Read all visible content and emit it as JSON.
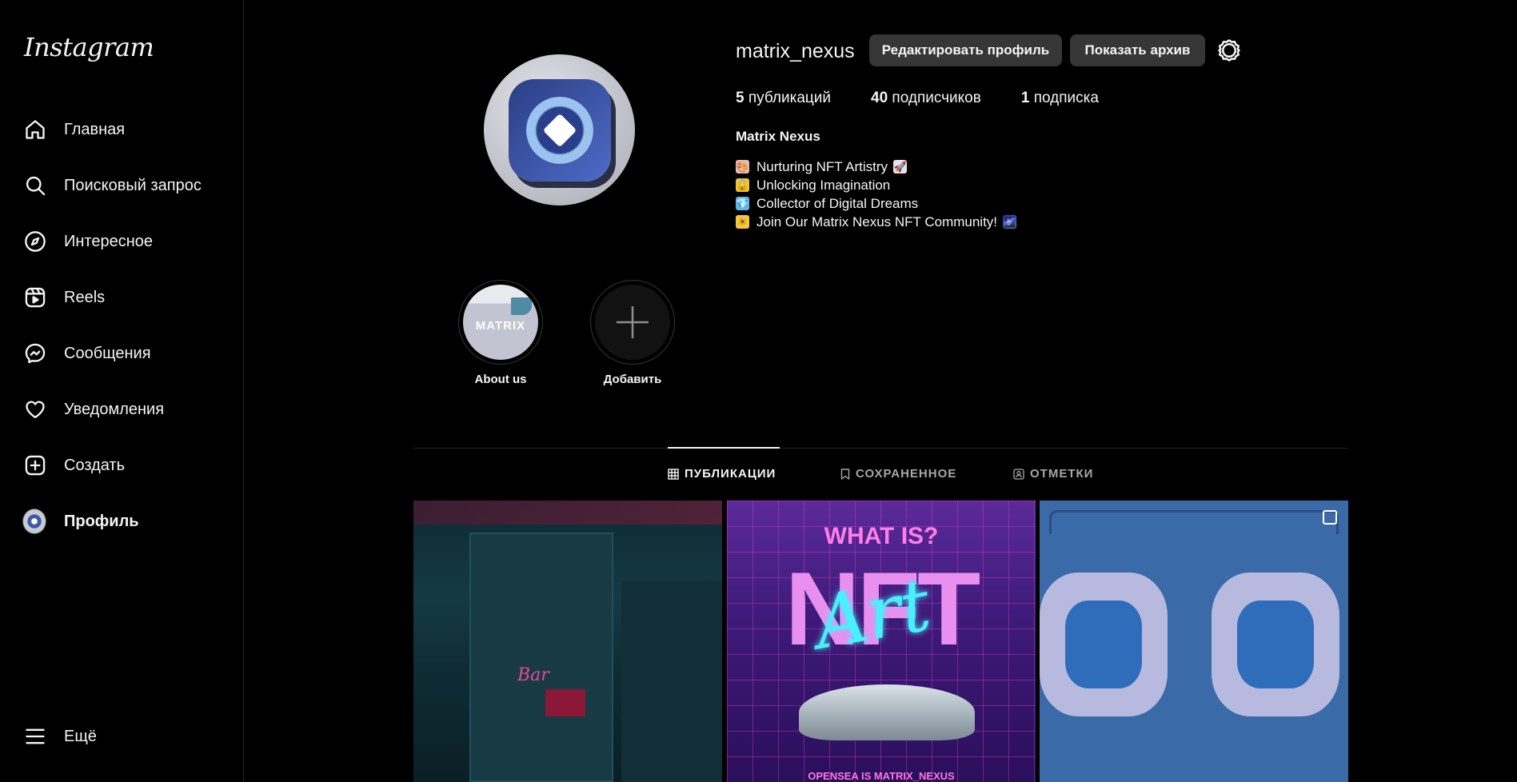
{
  "app": {
    "logo": "Instagram"
  },
  "sidebar": {
    "items": [
      {
        "label": "Главная",
        "icon": "home-icon"
      },
      {
        "label": "Поисковый запрос",
        "icon": "search-icon"
      },
      {
        "label": "Интересное",
        "icon": "compass-icon"
      },
      {
        "label": "Reels",
        "icon": "reels-icon"
      },
      {
        "label": "Сообщения",
        "icon": "messenger-icon"
      },
      {
        "label": "Уведомления",
        "icon": "heart-icon"
      },
      {
        "label": "Создать",
        "icon": "plus-square-icon"
      },
      {
        "label": "Профиль",
        "icon": "avatar"
      }
    ],
    "more": {
      "label": "Ещё",
      "icon": "menu-icon"
    }
  },
  "profile": {
    "username": "matrix_nexus",
    "edit_button": "Редактировать профиль",
    "archive_button": "Показать архив",
    "stats": {
      "posts_count": "5",
      "posts_label": "публикаций",
      "followers_count": "40",
      "followers_label": "подписчиков",
      "following_count": "1",
      "following_label": "подписка"
    },
    "full_name": "Matrix Nexus",
    "bio": [
      {
        "text": "Nurturing NFT Artistry",
        "lead_emoji": "🎨",
        "trail_emoji": "🚀"
      },
      {
        "text": "Unlocking Imagination",
        "lead_emoji": "🔓",
        "trail_emoji": ""
      },
      {
        "text": "Collector of Digital Dreams",
        "lead_emoji": "💎",
        "trail_emoji": ""
      },
      {
        "text": "Join Our Matrix Nexus NFT Community!",
        "lead_emoji": "☀",
        "trail_emoji": "🌌"
      }
    ]
  },
  "highlights": [
    {
      "label": "About us",
      "cover_text": "MATRIX"
    },
    {
      "label": "Добавить"
    }
  ],
  "tabs": [
    {
      "label": "ПУБЛИКАЦИИ",
      "icon": "grid-icon",
      "active": true
    },
    {
      "label": "СОХРАНЕННОЕ",
      "icon": "bookmark-icon",
      "active": false
    },
    {
      "label": "ОТМЕТКИ",
      "icon": "tag-user-icon",
      "active": false
    }
  ],
  "posts": [
    {
      "neon_sign": "Bar"
    },
    {
      "title_top": "WHAT IS?",
      "title_big": "NFT",
      "script": "Art",
      "caption": "OPENSEA IS MATRIX_NEXUS"
    },
    {
      "multi": true
    }
  ]
}
